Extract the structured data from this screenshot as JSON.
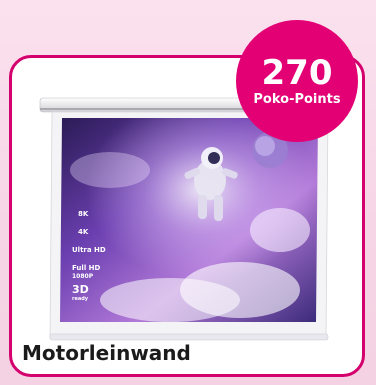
{
  "badge": {
    "points": "270",
    "label": "Poko-Points"
  },
  "product": {
    "title": "Motorleinwand",
    "specs": [
      "8K",
      "4K",
      "Ultra HD",
      "Full HD",
      "1080P",
      "3D"
    ],
    "specs_sub": "ready"
  },
  "colors": {
    "accent": "#e20074",
    "border": "#d4006d",
    "background": "#f6d5e6"
  }
}
